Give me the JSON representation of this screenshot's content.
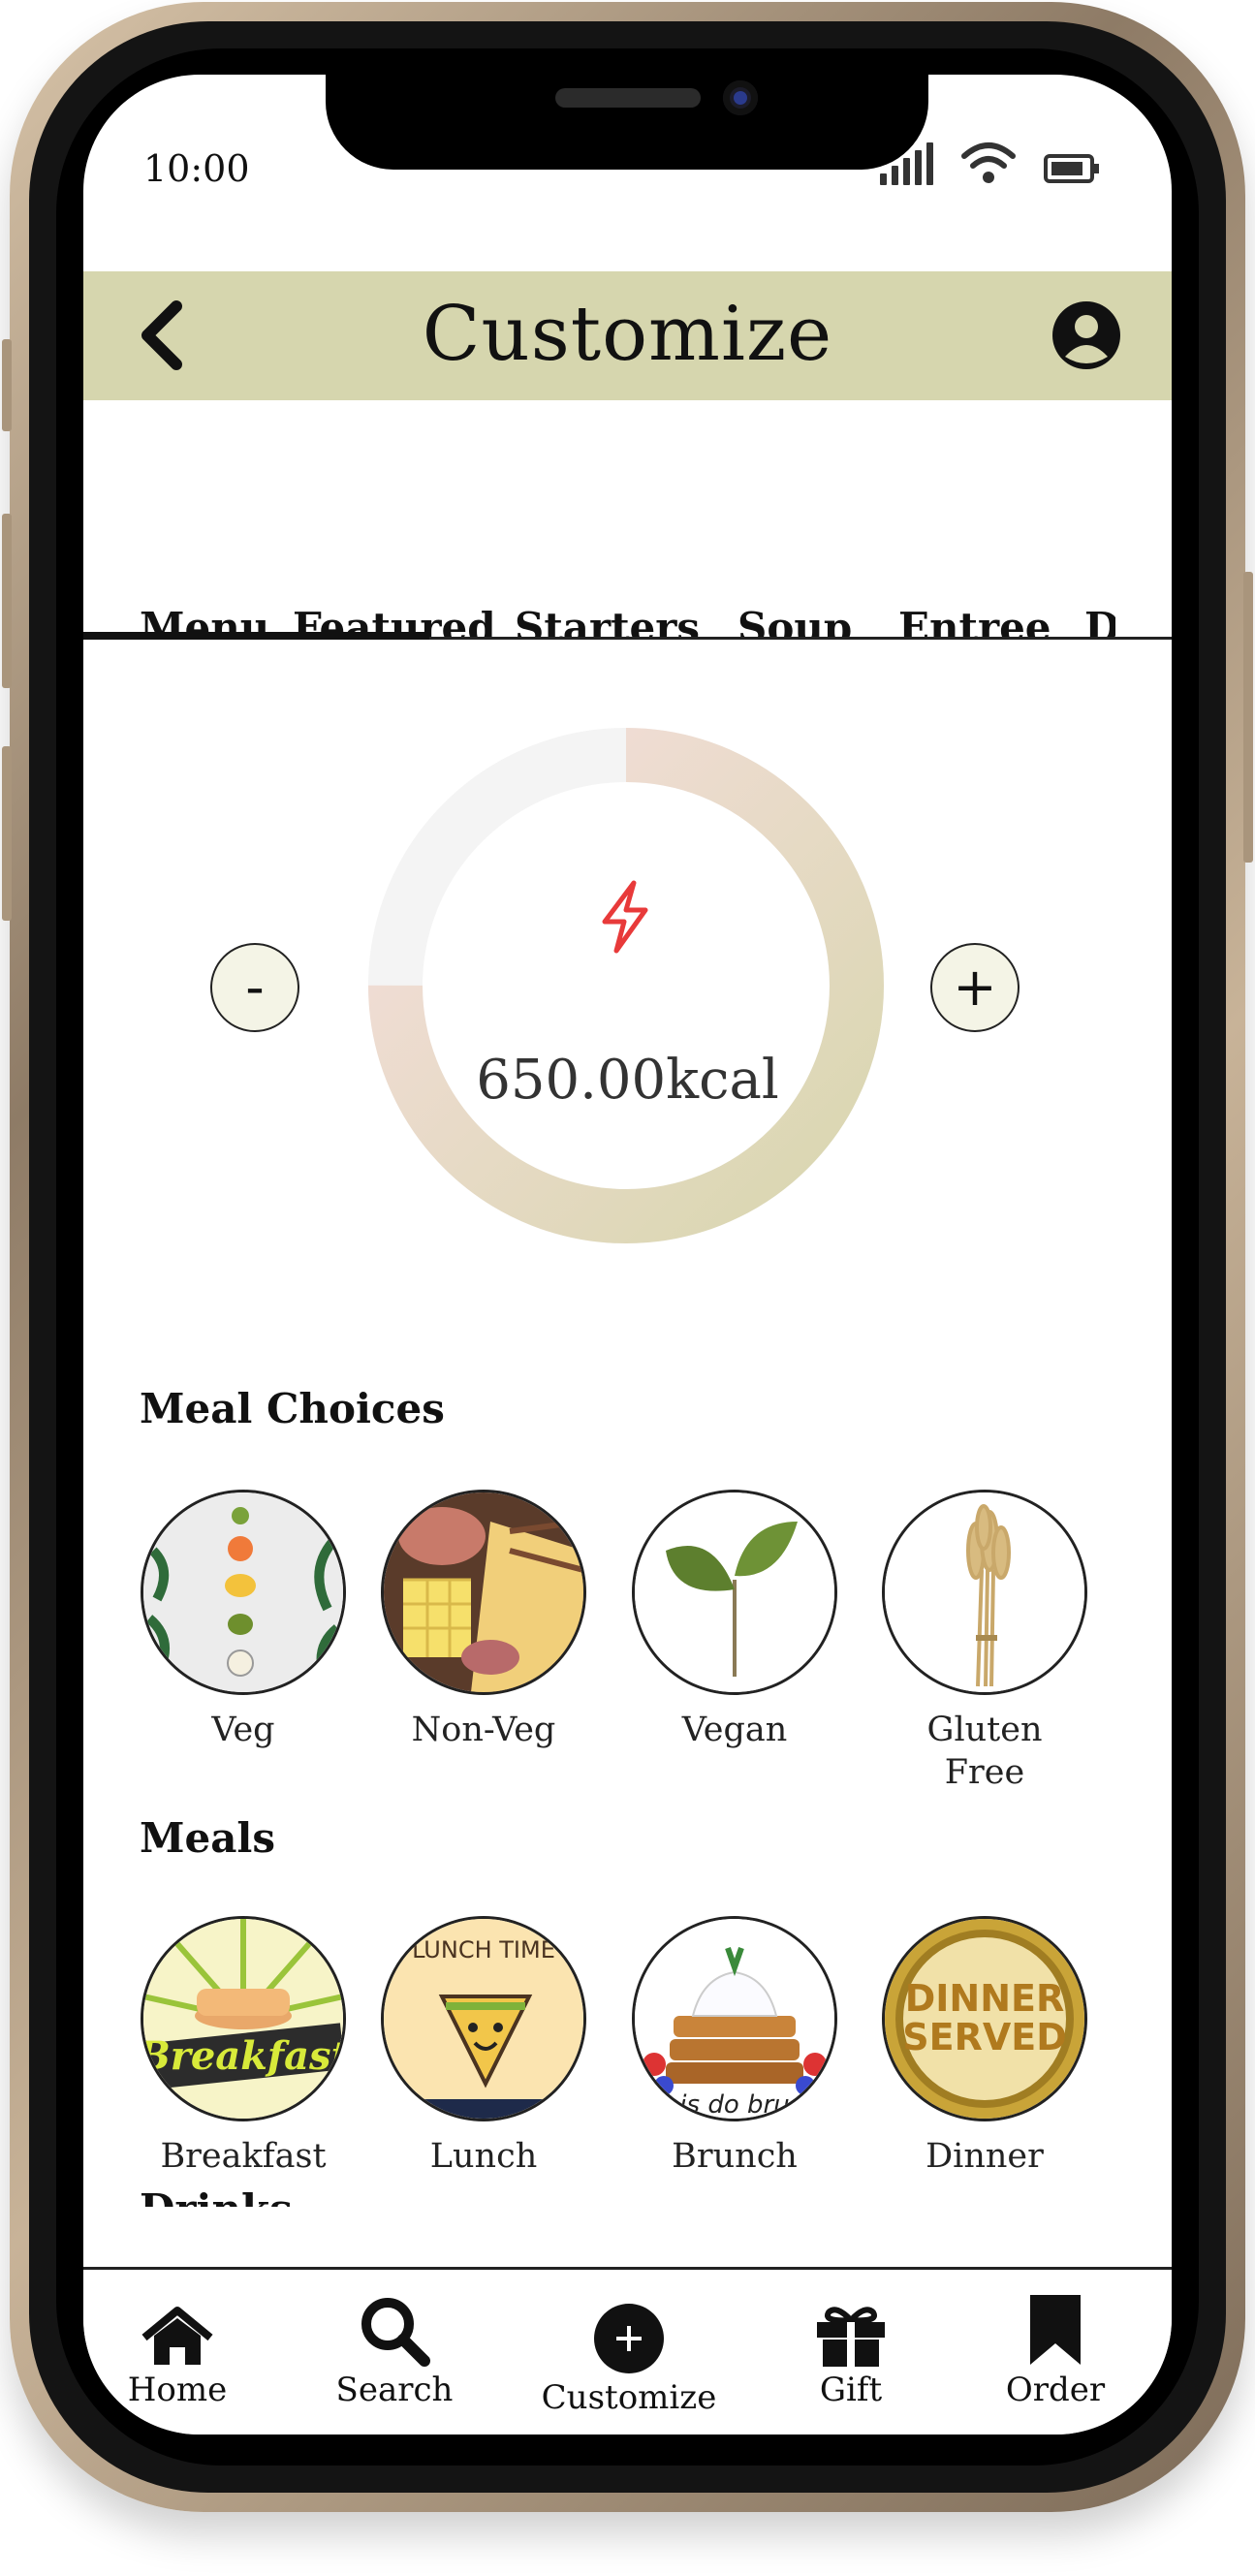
{
  "status": {
    "time": "10:00"
  },
  "header": {
    "title": "Customize"
  },
  "tabs": [
    "Menu",
    "Featured",
    "Starters",
    "Soup",
    "Entree",
    "D"
  ],
  "calories": {
    "value": "650.00kcal",
    "minus_label": "-",
    "plus_label": "+",
    "ring_fraction": 0.75
  },
  "meal_choices": {
    "title": "Meal Choices",
    "items": [
      {
        "label": "Veg"
      },
      {
        "label": "Non-Veg"
      },
      {
        "label": "Vegan"
      },
      {
        "label": "Gluten Free"
      }
    ]
  },
  "meals": {
    "title": "Meals",
    "items": [
      {
        "label": "Breakfast",
        "art_text": "Breakfast"
      },
      {
        "label": "Lunch",
        "art_text": "LUNCH TIME"
      },
      {
        "label": "Brunch",
        "art_text": "is do bru"
      },
      {
        "label": "Dinner",
        "art_text": "DINNER SERVED"
      }
    ]
  },
  "drinks": {
    "title": "Drinks"
  },
  "bottom_nav": [
    {
      "label": "Home",
      "icon": "home-icon"
    },
    {
      "label": "Search",
      "icon": "search-icon"
    },
    {
      "label": "Customize",
      "icon": "plus-circle-icon"
    },
    {
      "label": "Gift",
      "icon": "gift-icon"
    },
    {
      "label": "Order",
      "icon": "bookmark-icon"
    }
  ],
  "colors": {
    "header_bg": "#d6d6ae",
    "bolt": "#e83a3a",
    "ring_start": "#d8d6ae",
    "ring_end": "#f6dede",
    "ring_track": "#f4f4f4"
  }
}
